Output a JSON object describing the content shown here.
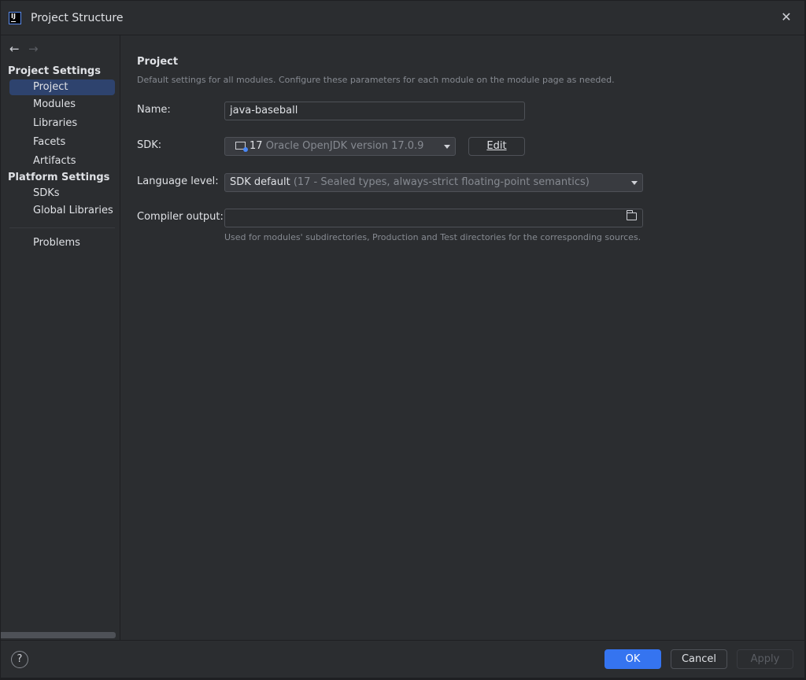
{
  "window": {
    "title": "Project Structure"
  },
  "sidebar": {
    "project_settings_header": "Project Settings",
    "project_settings_items": [
      {
        "label": "Project",
        "selected": true
      },
      {
        "label": "Modules"
      },
      {
        "label": "Libraries"
      },
      {
        "label": "Facets"
      },
      {
        "label": "Artifacts"
      }
    ],
    "platform_settings_header": "Platform Settings",
    "platform_settings_items": [
      {
        "label": "SDKs"
      },
      {
        "label": "Global Libraries"
      }
    ],
    "problems_label": "Problems"
  },
  "main": {
    "section_title": "Project",
    "section_description": "Default settings for all modules. Configure these parameters for each module on the module page as needed.",
    "name_label": "Name:",
    "name_value": "java-baseball",
    "sdk_label": "SDK:",
    "sdk_version": "17",
    "sdk_name": "Oracle OpenJDK version 17.0.9",
    "edit_button": "Edit",
    "language_level_label": "Language level:",
    "language_level_value": "SDK default",
    "language_level_detail": "(17 - Sealed types, always-strict floating-point semantics)",
    "compiler_output_label": "Compiler output:",
    "compiler_output_value": "",
    "compiler_output_hint": "Used for modules' subdirectories, Production and Test directories for the corresponding sources."
  },
  "footer": {
    "help_icon": "?",
    "ok_button": "OK",
    "cancel_button": "Cancel",
    "apply_button": "Apply"
  },
  "colors": {
    "accent": "#3574f0",
    "selection": "#2e436e",
    "background": "#2b2d30"
  }
}
